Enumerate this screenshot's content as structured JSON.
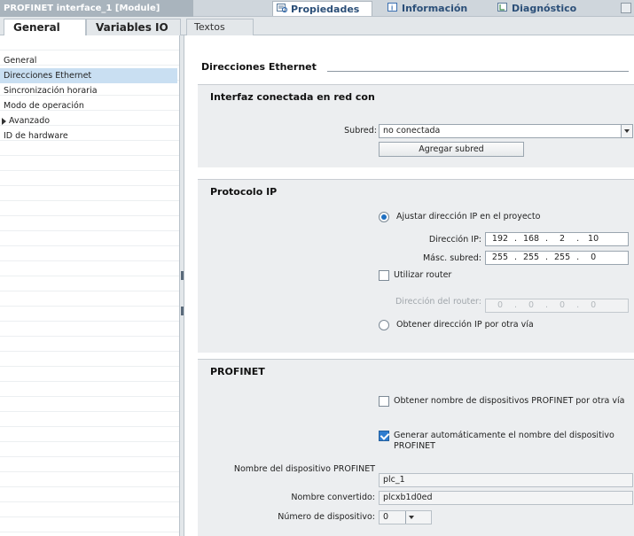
{
  "titlebar": {
    "title": "PROFINET interface_1 [Module]",
    "tabs": [
      {
        "label": "Propiedades",
        "icon": "properties-icon"
      },
      {
        "label": "Información",
        "icon": "info-icon"
      },
      {
        "label": "Diagnóstico",
        "icon": "diagnostics-icon"
      }
    ]
  },
  "subtabs": [
    "General",
    "Variables IO",
    "Textos"
  ],
  "nav": {
    "items": [
      {
        "label": "General"
      },
      {
        "label": "Direcciones Ethernet"
      },
      {
        "label": "Sincronización horaria"
      },
      {
        "label": "Modo de operación"
      },
      {
        "label": "Avanzado"
      },
      {
        "label": "ID de hardware"
      }
    ]
  },
  "content": {
    "heading": "Direcciones Ethernet",
    "network": {
      "title": "Interfaz conectada en red con",
      "subnet_label": "Subred:",
      "subnet_value": "no conectada",
      "add_subnet": "Agregar subred"
    },
    "ip": {
      "title": "Protocolo IP",
      "set_in_project": "Ajustar dirección IP en el proyecto",
      "ip_label": "Dirección IP:",
      "ip": [
        "192",
        "168",
        "2",
        "10"
      ],
      "mask_label": "Másc. subred:",
      "mask": [
        "255",
        "255",
        "255",
        "0"
      ],
      "use_router": "Utilizar router",
      "router_label": "Dirección del router:",
      "router": [
        "0",
        "0",
        "0",
        "0"
      ],
      "other_way": "Obtener dirección IP por otra vía"
    },
    "profinet": {
      "title": "PROFINET",
      "obtain_name": "Obtener nombre de dispositivos PROFINET por otra vía",
      "auto_name": "Generar automáticamente el nombre del dispositivo PROFINET",
      "device_name_label": "Nombre del dispositivo PROFINET",
      "device_name": "plc_1",
      "converted_label": "Nombre convertido:",
      "converted": "plcxb1d0ed",
      "number_label": "Número de dispositivo:",
      "number": "0"
    }
  }
}
